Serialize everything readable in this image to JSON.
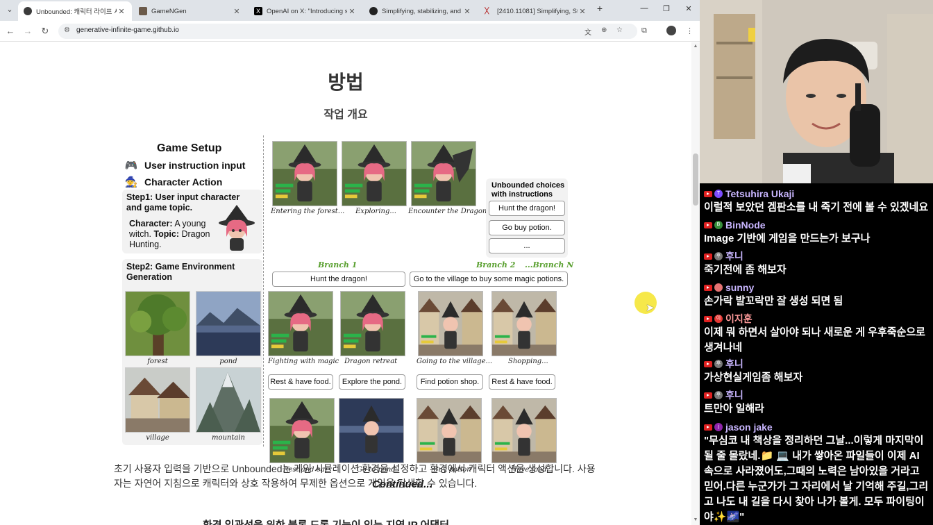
{
  "browser": {
    "tabs": [
      {
        "title": "Unbounded: 캐릭터 라이프 시",
        "active": true
      },
      {
        "title": "GameNGen",
        "active": false
      },
      {
        "title": "OpenAI on X: \"Introducing sC",
        "active": false
      },
      {
        "title": "Simplifying, stabilizing, and sc",
        "active": false
      },
      {
        "title": "[2410.11081] Simplifying, Stab",
        "active": false
      }
    ],
    "new_tab": "+",
    "url": "generative-infinite-game.github.io"
  },
  "page": {
    "heading": "방법",
    "subheading": "작업 개요",
    "figure": {
      "game_setup_title": "Game Setup",
      "user_instruction": "User instruction input",
      "character_action": "Character Action",
      "step1_title": "Step1: User input character and game topic.",
      "step1_char_label": "Character:",
      "step1_char_value": " A young witch. ",
      "step1_topic_label": "Topic:",
      "step1_topic_value": " Dragon Hunting.",
      "step2_title": "Step2: Game Environment Generation",
      "env_labels": [
        "forest",
        "pond",
        "village",
        "mountain"
      ],
      "top_captions": [
        "Entering the forest...",
        "Exploring...",
        "Encounter the Dragon!"
      ],
      "choices_title": "Unbounded choices with instructions",
      "choices": [
        "Hunt the dragon!",
        "Go buy potion.",
        "..."
      ],
      "branches": [
        "Branch 1",
        "Branch 2",
        "...Branch N"
      ],
      "branch_instructions": [
        "Hunt the dragon!",
        "Go to the village to buy some magic potions."
      ],
      "mid_captions": [
        "Fighting with magic",
        "Dragon retreat",
        "Going to the village...",
        "Shopping..."
      ],
      "sub_instructions": [
        "Rest & have food.",
        "Explore the pond.",
        "Find potion shop.",
        "Rest & have food."
      ],
      "bottom_captions": [
        "Rest and eat",
        "Go to pond",
        "Buy potion",
        "Have food"
      ],
      "continued": "Continued..."
    },
    "paragraph": "초기 사용자 입력을 기반으로 Unbounded는 게임 시뮬레이션 환경을 설정하고 환경에서 캐릭터 액션을 생성합니다. 사용자는 자연어 지침으로 캐릭터와 상호 작용하여 무제한 옵션으로 게임을 탐색할 수 있습니다.",
    "next_heading": "환경 일관성을 위한 블록 드롭 기능이 있는 지역 IP 어댑터"
  },
  "chat": {
    "messages": [
      {
        "name": "Tetsuhira Ukaji",
        "avatar": "T",
        "color": "#c9b6ff",
        "avatar_bg": "#7c4dff",
        "text": "이럴적 보았던 겜판소를 내 죽기 전에 볼 수 있겠네요"
      },
      {
        "name": "BinNode",
        "avatar": "B",
        "color": "#c9b6ff",
        "avatar_bg": "#388e3c",
        "text": "Image 기반에 게임을 만드는가 보구나"
      },
      {
        "name": "후니",
        "avatar": "후",
        "color": "#c9b6ff",
        "avatar_bg": "#777777",
        "text": "죽기전에 좀 해보자"
      },
      {
        "name": "sunny",
        "avatar": "",
        "color": "#c9b6ff",
        "avatar_bg": "#e57373",
        "text": "손가락 발꼬락만 잘 생성 되면 됨"
      },
      {
        "name": "이지훈",
        "avatar": "이",
        "color": "#ff9b9b",
        "avatar_bg": "#e53935",
        "text": "이제 뭐 하면서 살아야 되나 새로운 게 우후죽순으로 생겨나네"
      },
      {
        "name": "후니",
        "avatar": "후",
        "color": "#c9b6ff",
        "avatar_bg": "#777777",
        "text": "가상현실게임좀 해보자"
      },
      {
        "name": "후니",
        "avatar": "후",
        "color": "#c9b6ff",
        "avatar_bg": "#777777",
        "text": "트만아 일해라"
      },
      {
        "name": "jason jake",
        "avatar": "j",
        "color": "#c9b6ff",
        "avatar_bg": "#8e24aa",
        "text": "\"무심코 내 책상을 정리하던 그날...이렇게 마지막이 될 줄 몰랐네.📁 💻 내가 쌓아온 파일들이 이제 AI 속으로 사라졌어도,그때의 노력은 남아있을 거라고 믿어.다른 누군가가 그 자리에서 날 기억해 주길,그리고 나도 내 길을 다시 찾아 나가 볼게. 모두 파이팅이야✨🌌\""
      }
    ]
  }
}
